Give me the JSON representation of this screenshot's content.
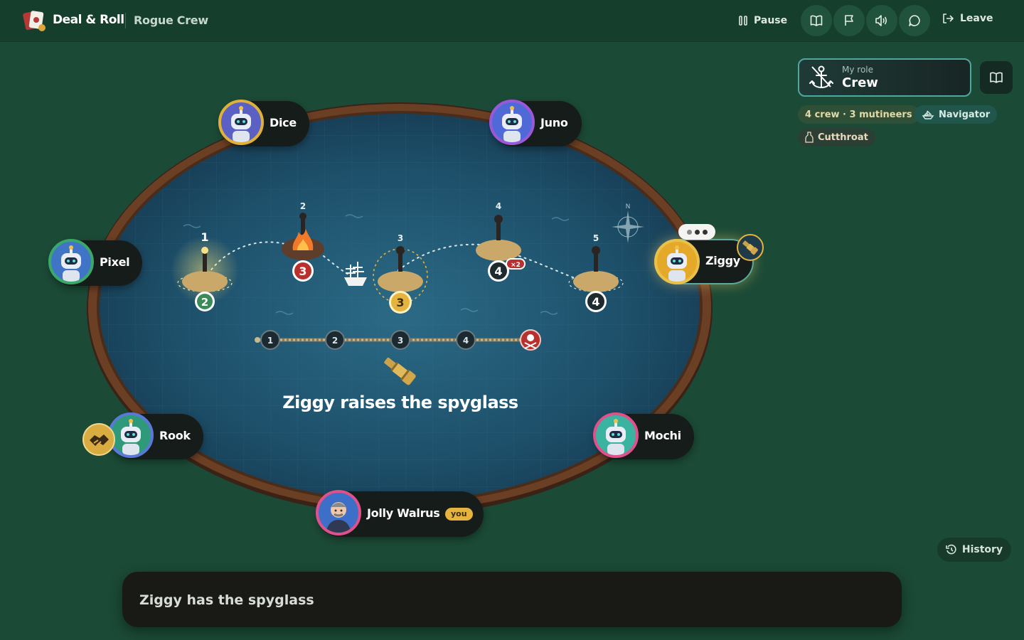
{
  "header": {
    "brand": "Deal & Roll",
    "game_name": "Rogue Crew",
    "pause_label": "Pause",
    "leave_label": "Leave"
  },
  "board": {
    "announcement": "Ziggy raises the spyglass",
    "islands": [
      {
        "number": "1",
        "value": "2"
      },
      {
        "number": "2",
        "value": "3"
      },
      {
        "number": "3",
        "value": "3"
      },
      {
        "number": "4",
        "value": "4",
        "multiplier": "×2"
      },
      {
        "number": "5",
        "value": "4"
      }
    ],
    "track": [
      "1",
      "2",
      "3",
      "4"
    ],
    "compass": "N"
  },
  "players": [
    {
      "name": "Dice"
    },
    {
      "name": "Juno"
    },
    {
      "name": "Pixel"
    },
    {
      "name": "Ziggy"
    },
    {
      "name": "Rook"
    },
    {
      "name": "Mochi"
    },
    {
      "name": "Jolly Walrus",
      "badge": "you"
    }
  ],
  "role_panel": {
    "label": "My role",
    "value": "Crew",
    "composition": "4 crew · 3 mutineers",
    "tags": [
      "Navigator",
      "Cutthroat"
    ]
  },
  "history_label": "History",
  "status_message": "Ziggy has the spyglass",
  "colors": {
    "background": "#1b4a36",
    "table_sea": "#1e4f6a",
    "table_rim": "#6b3f24",
    "gold": "#e4b43e",
    "danger": "#b9312e"
  },
  "icons": [
    "pause-icon",
    "book-icon",
    "flag-icon",
    "volume-icon",
    "chat-icon",
    "leave-icon",
    "anchor-icon",
    "ship-icon",
    "spyglass-icon",
    "compass-icon",
    "history-icon",
    "skull-icon",
    "fire-icon"
  ]
}
